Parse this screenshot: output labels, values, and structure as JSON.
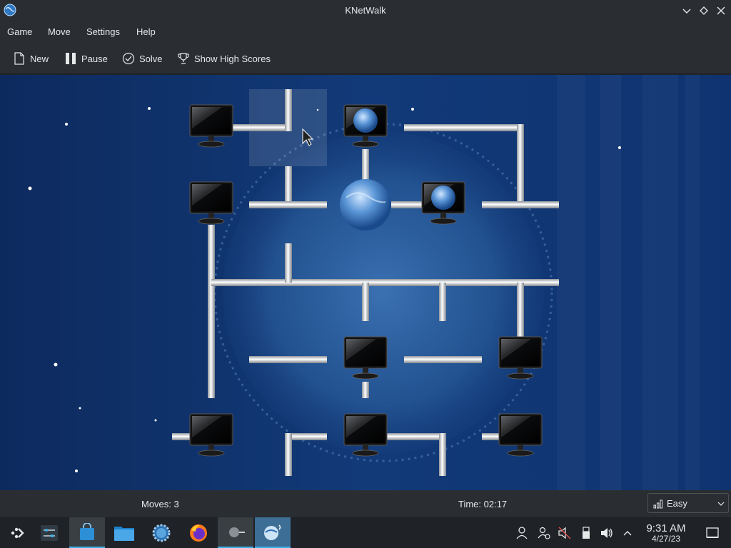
{
  "window": {
    "title": "KNetWalk"
  },
  "menu": [
    "Game",
    "Move",
    "Settings",
    "Help"
  ],
  "toolbar": {
    "new_label": "New",
    "pause_label": "Pause",
    "solve_label": "Solve",
    "highscores_label": "Show High Scores"
  },
  "status": {
    "moves": "Moves: 3",
    "time": "Time: 02:17",
    "difficulty": "Easy"
  },
  "taskbar": {
    "apps": [
      "application-launcher",
      "system-settings-panel",
      "discover-store",
      "dolphin-file-manager",
      "system-settings",
      "firefox",
      "knetwalk-other",
      "knetwalk"
    ],
    "clock_time": "9:31 AM",
    "clock_date": "4/27/23"
  },
  "board": {
    "tiles": [
      {
        "row": 0,
        "col": 0,
        "type": "computer"
      },
      {
        "row": 0,
        "col": 1,
        "type": "pipe-corner"
      },
      {
        "row": 0,
        "col": 2,
        "type": "computer-server"
      },
      {
        "row": 0,
        "col": 3,
        "type": "pipe-corner"
      },
      {
        "row": 1,
        "col": 0,
        "type": "computer"
      },
      {
        "row": 1,
        "col": 1,
        "type": "pipe-t"
      },
      {
        "row": 1,
        "col": 2,
        "type": "server"
      },
      {
        "row": 1,
        "col": 3,
        "type": "computer-server"
      },
      {
        "row": 1,
        "col": 4,
        "type": "pipe-corner"
      },
      {
        "row": 2,
        "col": 0,
        "type": "pipe-t"
      },
      {
        "row": 2,
        "col": 1,
        "type": "pipe-cross"
      },
      {
        "row": 2,
        "col": 2,
        "type": "pipe-t"
      },
      {
        "row": 2,
        "col": 3,
        "type": "pipe-t"
      },
      {
        "row": 2,
        "col": 4,
        "type": "pipe-corner"
      },
      {
        "row": 3,
        "col": 0,
        "type": "pipe-straight"
      },
      {
        "row": 3,
        "col": 1,
        "type": "pipe-stub"
      },
      {
        "row": 3,
        "col": 2,
        "type": "computer"
      },
      {
        "row": 3,
        "col": 3,
        "type": "pipe-stub"
      },
      {
        "row": 3,
        "col": 4,
        "type": "computer"
      },
      {
        "row": 4,
        "col": 0,
        "type": "computer"
      },
      {
        "row": 4,
        "col": 1,
        "type": "pipe-corner"
      },
      {
        "row": 4,
        "col": 2,
        "type": "computer"
      },
      {
        "row": 4,
        "col": 3,
        "type": "pipe-corner"
      },
      {
        "row": 4,
        "col": 4,
        "type": "computer"
      }
    ],
    "hovered_tile": {
      "row": 0,
      "col": 1
    }
  }
}
